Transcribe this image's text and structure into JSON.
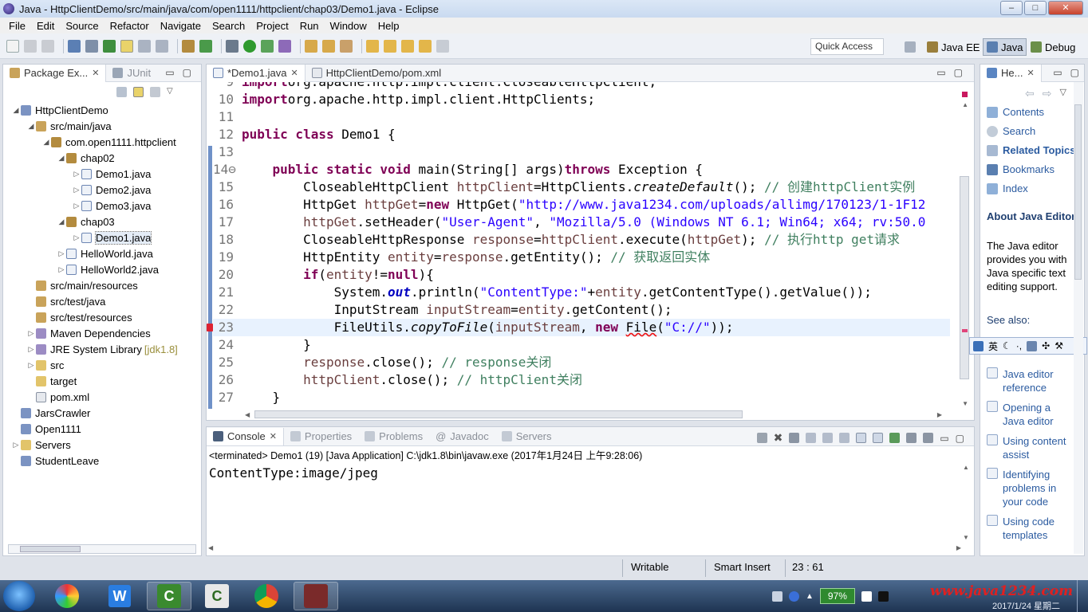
{
  "window": {
    "title": "Java - HttpClientDemo/src/main/java/com/open1111/httpclient/chap03/Demo1.java - Eclipse",
    "buttons": {
      "minimize": "–",
      "maximize": "□",
      "close": "✕"
    }
  },
  "menubar": [
    "File",
    "Edit",
    "Source",
    "Refactor",
    "Navigate",
    "Search",
    "Project",
    "Run",
    "Window",
    "Help"
  ],
  "toolbar": {
    "quick_access": "Quick Access",
    "perspectives": [
      "Java EE",
      "Java",
      "Debug"
    ]
  },
  "package_explorer": {
    "tabs": [
      "Package Ex...",
      "JUnit"
    ],
    "items": [
      {
        "label": "HttpClientDemo",
        "extra": ""
      },
      {
        "label": "src/main/java",
        "extra": ""
      },
      {
        "label": "com.open1111.httpclient",
        "extra": ""
      },
      {
        "label": "chap02",
        "extra": ""
      },
      {
        "label": "Demo1.java",
        "extra": ""
      },
      {
        "label": "Demo2.java",
        "extra": ""
      },
      {
        "label": "Demo3.java",
        "extra": ""
      },
      {
        "label": "chap03",
        "extra": ""
      },
      {
        "label": "Demo1.java",
        "extra": ""
      },
      {
        "label": "HelloWorld.java",
        "extra": ""
      },
      {
        "label": "HelloWorld2.java",
        "extra": ""
      },
      {
        "label": "src/main/resources",
        "extra": ""
      },
      {
        "label": "src/test/java",
        "extra": ""
      },
      {
        "label": "src/test/resources",
        "extra": ""
      },
      {
        "label": "Maven Dependencies",
        "extra": ""
      },
      {
        "label": "JRE System Library",
        "extra": "[jdk1.8]"
      },
      {
        "label": "src",
        "extra": ""
      },
      {
        "label": "target",
        "extra": ""
      },
      {
        "label": "pom.xml",
        "extra": ""
      },
      {
        "label": "JarsCrawler",
        "extra": ""
      },
      {
        "label": "Open1111",
        "extra": ""
      },
      {
        "label": "Servers",
        "extra": ""
      },
      {
        "label": "StudentLeave",
        "extra": ""
      }
    ]
  },
  "editor": {
    "tabs": [
      "*Demo1.java",
      "HttpClientDemo/pom.xml"
    ],
    "lines": [
      {
        "n": "9",
        "tokens": [
          [
            "kw",
            "import"
          ],
          [
            "",
            "org.apache.http.impl.client.CloseableHttpClient;"
          ]
        ]
      },
      {
        "n": "10",
        "tokens": [
          [
            "kw",
            "import"
          ],
          [
            "",
            "org.apache.http.impl.client.HttpClients;"
          ]
        ]
      },
      {
        "n": "11",
        "tokens": []
      },
      {
        "n": "12",
        "tokens": [
          [
            "kw",
            "public class"
          ],
          [
            "",
            " Demo1 {"
          ]
        ]
      },
      {
        "n": "13",
        "tokens": []
      },
      {
        "n": "14⊖",
        "tokens": [
          [
            "",
            "    "
          ],
          [
            "kw",
            "public static void"
          ],
          [
            "",
            " main(String[] args)"
          ],
          [
            "kw",
            "throws"
          ],
          [
            "",
            " Exception {"
          ]
        ]
      },
      {
        "n": "15",
        "tokens": [
          [
            "",
            "        CloseableHttpClient "
          ],
          [
            "var",
            "httpClient"
          ],
          [
            "",
            "=HttpClients."
          ],
          [
            "mth",
            "createDefault"
          ],
          [
            "",
            "(); "
          ],
          [
            "cmt",
            "// 创建httpClient实例"
          ]
        ]
      },
      {
        "n": "16",
        "tokens": [
          [
            "",
            "        HttpGet "
          ],
          [
            "var",
            "httpGet"
          ],
          [
            "",
            "="
          ],
          [
            "kw",
            "new"
          ],
          [
            "",
            " HttpGet("
          ],
          [
            "str",
            "\"http://www.java1234.com/uploads/allimg/170123/1-1F12"
          ]
        ]
      },
      {
        "n": "17",
        "tokens": [
          [
            "",
            "        "
          ],
          [
            "var",
            "httpGet"
          ],
          [
            "",
            ".setHeader("
          ],
          [
            "str",
            "\"User-Agent\""
          ],
          [
            "",
            ", "
          ],
          [
            "str",
            "\"Mozilla/5.0 (Windows NT 6.1; Win64; x64; rv:50.0"
          ]
        ]
      },
      {
        "n": "18",
        "tokens": [
          [
            "",
            "        CloseableHttpResponse "
          ],
          [
            "var",
            "response"
          ],
          [
            "",
            "="
          ],
          [
            "var",
            "httpClient"
          ],
          [
            "",
            ".execute("
          ],
          [
            "var",
            "httpGet"
          ],
          [
            "",
            "); "
          ],
          [
            "cmt",
            "// 执行http get请求"
          ]
        ]
      },
      {
        "n": "19",
        "tokens": [
          [
            "",
            "        HttpEntity "
          ],
          [
            "var",
            "entity"
          ],
          [
            "",
            "="
          ],
          [
            "var",
            "response"
          ],
          [
            "",
            ".getEntity(); "
          ],
          [
            "cmt",
            "// 获取返回实体"
          ]
        ]
      },
      {
        "n": "20",
        "tokens": [
          [
            "",
            "        "
          ],
          [
            "kw",
            "if"
          ],
          [
            "",
            "("
          ],
          [
            "var",
            "entity"
          ],
          [
            "",
            "!="
          ],
          [
            "kw",
            "null"
          ],
          [
            "",
            "){"
          ]
        ]
      },
      {
        "n": "21",
        "tokens": [
          [
            "",
            "            System."
          ],
          [
            "fld",
            "out"
          ],
          [
            "",
            ".println("
          ],
          [
            "str",
            "\"ContentType:\""
          ],
          [
            "",
            "+"
          ],
          [
            "var",
            "entity"
          ],
          [
            "",
            ".getContentType().getValue());"
          ]
        ]
      },
      {
        "n": "22",
        "tokens": [
          [
            "",
            "            InputStream "
          ],
          [
            "var",
            "inputStream"
          ],
          [
            "",
            "="
          ],
          [
            "var",
            "entity"
          ],
          [
            "",
            ".getContent();"
          ]
        ]
      },
      {
        "n": "23",
        "tokens": [
          [
            "",
            "            FileUtils."
          ],
          [
            "mth",
            "copyToFile"
          ],
          [
            "",
            "("
          ],
          [
            "var",
            "inputStream"
          ],
          [
            "",
            ", "
          ],
          [
            "kw",
            "new"
          ],
          [
            "",
            " "
          ],
          [
            "err",
            "File"
          ],
          [
            "",
            "("
          ],
          [
            "str",
            "\"C://\""
          ],
          [
            "",
            "));"
          ]
        ]
      },
      {
        "n": "24",
        "tokens": [
          [
            "",
            "        }"
          ]
        ]
      },
      {
        "n": "25",
        "tokens": [
          [
            "",
            "        "
          ],
          [
            "var",
            "response"
          ],
          [
            "",
            ".close(); "
          ],
          [
            "cmt",
            "// response关闭"
          ]
        ]
      },
      {
        "n": "26",
        "tokens": [
          [
            "",
            "        "
          ],
          [
            "var",
            "httpClient"
          ],
          [
            "",
            ".close(); "
          ],
          [
            "cmt",
            "// httpClient关闭"
          ]
        ]
      },
      {
        "n": "27",
        "tokens": [
          [
            "",
            "    }"
          ]
        ]
      }
    ]
  },
  "bottom_panel": {
    "tabs": [
      "Console",
      "Properties",
      "Problems",
      "Javadoc",
      "Servers"
    ],
    "status": "<terminated> Demo1 (19) [Java Application] C:\\jdk1.8\\bin\\javaw.exe (2017年1月24日 上午9:28:06)",
    "output": "ContentType:image/jpeg"
  },
  "help": {
    "tab": "He...",
    "links": [
      "Contents",
      "Search",
      "Related Topics",
      "Bookmarks",
      "Index"
    ],
    "about_title": "About Java Editor",
    "about_text": "The Java editor provides you with Java specific text editing support.",
    "see_also": "See also:",
    "items": [
      "Java editor reference",
      "Opening a Java editor",
      "Using content assist",
      "Identifying problems in your code",
      "Using code templates"
    ],
    "ime_label": "英"
  },
  "statusbar": {
    "writable": "Writable",
    "insert_mode": "Smart Insert",
    "position": "23 : 61"
  },
  "taskbar": {
    "battery": "97%",
    "watermark": "www.java1234.com",
    "date": "2017/1/24 星期二"
  },
  "colors": {
    "keyword": "#7f0055",
    "string": "#2a00ff",
    "comment": "#3f7f5f",
    "variable": "#6a3e3e",
    "watermark": "#e02020"
  }
}
